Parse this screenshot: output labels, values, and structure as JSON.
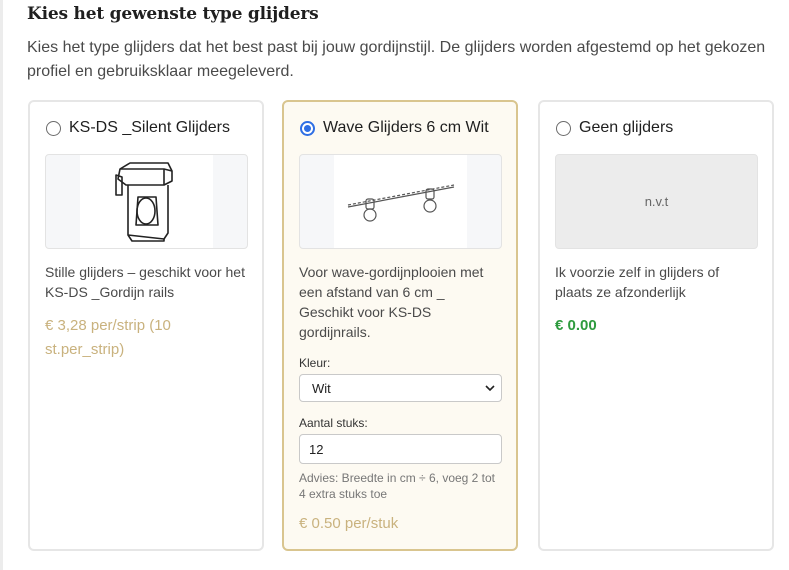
{
  "section": {
    "title": "Kies het gewenste type glijders",
    "intro": "Kies het type glijders dat het best past bij jouw gordijnstijl. De glijders worden afgestemd op het gekozen profiel en gebruiksklaar meegeleverd."
  },
  "options": [
    {
      "title": "KS-DS _Silent Glijders",
      "selected": false,
      "description": "Stille glijders – geschikt voor het KS-DS _Gordijn rails",
      "price": "€ 3,28 per/strip (10 st.per_strip)",
      "price_color": "#c9b27e"
    },
    {
      "title": "Wave Glijders 6 cm Wit",
      "selected": true,
      "description": "Voor wave-gordijnplooien met een afstand van 6 cm _ Geschikt voor KS-DS gordijnrails.",
      "color_label": "Kleur:",
      "color_value": "Wit",
      "quantity_label": "Aantal stuks:",
      "quantity_value": "12",
      "advice": "Advies: Breedte in cm ÷ 6, voeg 2 tot 4 extra stuks toe",
      "price": "€ 0.50 per/stuk",
      "price_color": "#c9b27e"
    },
    {
      "title": "Geen glijders",
      "selected": false,
      "image_placeholder": "n.v.t",
      "description": "Ik voorzie zelf in glijders of plaats ze afzonderlijk",
      "price": "€ 0.00",
      "price_color": "#2e9b3e"
    }
  ],
  "colors": {
    "selected_border": "#d9c58f",
    "selected_background": "#fdfaf2",
    "radio_checked": "#2f6fe4"
  }
}
